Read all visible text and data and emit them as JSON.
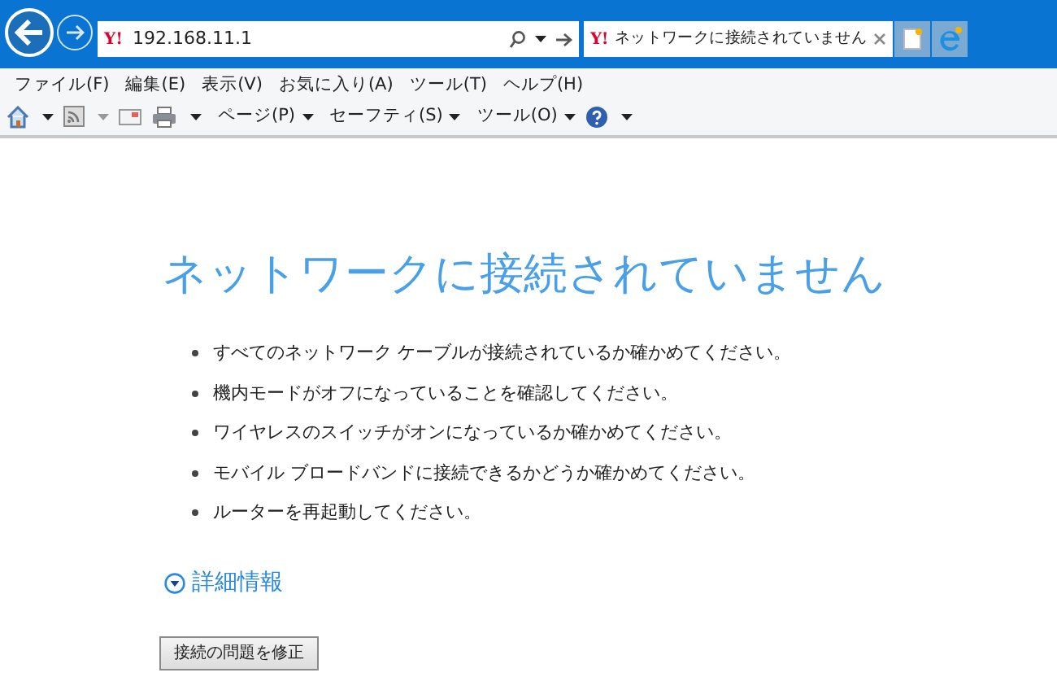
{
  "address_bar": {
    "site_logo": "Y!",
    "url": "192.168.11.1"
  },
  "tabs": [
    {
      "site_logo": "Y!",
      "title": "ネットワークに接続されていません",
      "selected": true
    }
  ],
  "menu_bar": [
    "ファイル(F)",
    "編集(E)",
    "表示(V)",
    "お気に入り(A)",
    "ツール(T)",
    "ヘルプ(H)"
  ],
  "command_bar": [
    {
      "kind": "home"
    },
    {
      "kind": "feed"
    },
    {
      "kind": "mail"
    },
    {
      "kind": "print"
    },
    {
      "kind": "menu",
      "label": "ページ(P)"
    },
    {
      "kind": "menu",
      "label": "セーフティ(S)"
    },
    {
      "kind": "menu",
      "label": "ツール(O)"
    },
    {
      "kind": "help"
    }
  ],
  "page": {
    "heading": "ネットワークに接続されていません",
    "tips": [
      "すべてのネットワーク ケーブルが接続されているか確かめてください。",
      "機内モードがオフになっていることを確認してください。",
      "ワイヤレスのスイッチがオンになっているか確かめてください。",
      "モバイル ブロードバンドに接続できるかどうか確かめてください。",
      "ルーターを再起動してください。"
    ],
    "details_link": "詳細情報",
    "fix_button": "接続の問題を修正"
  }
}
